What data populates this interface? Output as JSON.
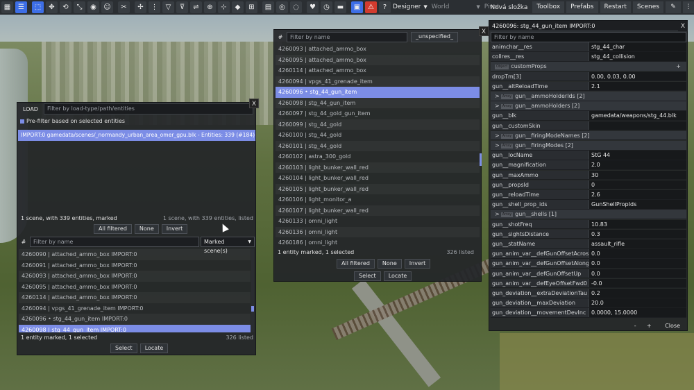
{
  "toolbar": {
    "mode": "Designer",
    "space": "World",
    "pivot": "Pivot",
    "folder_label": "Nová složka",
    "right_buttons": [
      "Toolbox",
      "Prefabs",
      "Restart",
      "Scenes"
    ]
  },
  "load": {
    "title": "LOAD",
    "filter_placeholder": "Filter by load-type/path/entities",
    "prefilter_label": "Pre-filter based on selected entities",
    "scene_row": "IMPORT:0  gamedata/scenes/_normandy_urban_area_omer_gpu.blk - Entities: 339  (#184)",
    "status_left": "1 scene, with 339 entities, marked",
    "status_right": "1 scene, with 339 entities, listed",
    "btn_all": "All filtered",
    "btn_none": "None",
    "btn_invert": "Invert",
    "hash": "#",
    "name_placeholder": "Filter by name",
    "marked_dropdown": "Marked scene(s)",
    "entities": [
      {
        "text": "4260090  |  attached_ammo_box     IMPORT:0"
      },
      {
        "text": "4260091  |  attached_ammo_box     IMPORT:0"
      },
      {
        "text": "4260093  |  attached_ammo_box     IMPORT:0"
      },
      {
        "text": "4260095  |  attached_ammo_box     IMPORT:0"
      },
      {
        "text": "4260114  |  attached_ammo_box     IMPORT:0"
      },
      {
        "text": "4260094  |  vpgs_41_grenade_item     IMPORT:0"
      },
      {
        "text": "4260096  •  stg_44_gun_item     IMPORT:0"
      },
      {
        "text": "4260098  |  stg_44_gun_item     IMPORT:0"
      }
    ],
    "footer_left": "1 entity marked, 1 selected",
    "footer_right": "326 listed",
    "btn_select": "Select",
    "btn_locate": "Locate",
    "close": "X"
  },
  "list": {
    "hash": "#",
    "filter_placeholder": "Filter by name",
    "tag": "_unspecified_",
    "close": "X",
    "items": [
      "4260093  |  attached_ammo_box",
      "4260095  |  attached_ammo_box",
      "4260114  |  attached_ammo_box",
      "4260094  |  vpgs_41_grenade_item",
      "4260096  •  stg_44_gun_item",
      "4260098  |  stg_44_gun_item",
      "4260097  |  stg_44_gold_gun_item",
      "4260099  |  stg_44_gold",
      "4260100  |  stg_44_gold",
      "4260101  |  stg_44_gold",
      "4260102  |  astra_300_gold",
      "4260103  |  light_bunker_wall_red",
      "4260104  |  light_bunker_wall_red",
      "4260105  |  light_bunker_wall_red",
      "4260106  |  light_monitor_a",
      "4260107  |  light_bunker_wall_red",
      "4260133  |  omni_light",
      "4260136  |  omni_light",
      "4260186  |  omni_light"
    ],
    "selected_index": 4,
    "footer_left": "1 entity marked, 1 selected",
    "footer_right": "326 listed",
    "btn_all": "All filtered",
    "btn_none": "None",
    "btn_invert": "Invert",
    "btn_select": "Select",
    "btn_locate": "Locate"
  },
  "props": {
    "title": "4260096: stg_44_gun_item  IMPORT:0",
    "close": "X",
    "filter_placeholder": "Filter by name",
    "rows": [
      {
        "k": "animchar__res",
        "v": "stg_44_char"
      },
      {
        "k": "collres__res",
        "v": "stg_44_collision"
      },
      {
        "group": "customProps",
        "tag": "Object",
        "plus": "+"
      },
      {
        "k": "dropTm[3]",
        "v": "0.00, 0.03, 0.00"
      },
      {
        "k": "gun__altReloadTime",
        "v": "2.1"
      },
      {
        "group": "gun__ammoHolderIds [2]",
        "tag": "Array",
        "arrow": ">"
      },
      {
        "group": "gun__ammoHolders [2]",
        "tag": "Array",
        "arrow": ">"
      },
      {
        "k": "gun__blk",
        "v": "gamedata/weapons/stg_44.blk"
      },
      {
        "k": "gun__customSkin",
        "v": ""
      },
      {
        "group": "gun__firingModeNames [2]",
        "tag": "Array",
        "arrow": ">"
      },
      {
        "group": "gun__firingModes [2]",
        "tag": "Array",
        "arrow": ">"
      },
      {
        "k": "gun__locName",
        "v": "StG 44"
      },
      {
        "k": "gun__magnification",
        "v": "2.0"
      },
      {
        "k": "gun__maxAmmo",
        "v": "30"
      },
      {
        "k": "gun__propsId",
        "v": "0"
      },
      {
        "k": "gun__reloadTime",
        "v": "2.6"
      },
      {
        "k": "gun__shell_prop_ids",
        "v": "GunShellPropIds"
      },
      {
        "group": "gun__shells [1]",
        "tag": "Array",
        "arrow": ">"
      },
      {
        "k": "gun__shotFreq",
        "v": "10.83"
      },
      {
        "k": "gun__sightsDistance",
        "v": "0.3"
      },
      {
        "k": "gun__statName",
        "v": "assault_rifle"
      },
      {
        "k": "gun_anim_var__defGunOffsetAcross",
        "v": "0.0"
      },
      {
        "k": "gun_anim_var__defGunOffsetAlong",
        "v": "0.0"
      },
      {
        "k": "gun_anim_var__defGunOffsetUp",
        "v": "0.0"
      },
      {
        "k": "gun_anim_var__defEyeOffsetFwd0",
        "v": "-0.0"
      },
      {
        "k": "gun_deviation__extraDeviationTau",
        "v": "0.2"
      },
      {
        "k": "gun_deviation__maxDeviation",
        "v": "20.0"
      },
      {
        "k": "gun_deviation__movementDevInc",
        "v": "0.0000, 15.0000"
      }
    ],
    "btn_minus": "-",
    "btn_plus": "+",
    "btn_close": "Close"
  }
}
